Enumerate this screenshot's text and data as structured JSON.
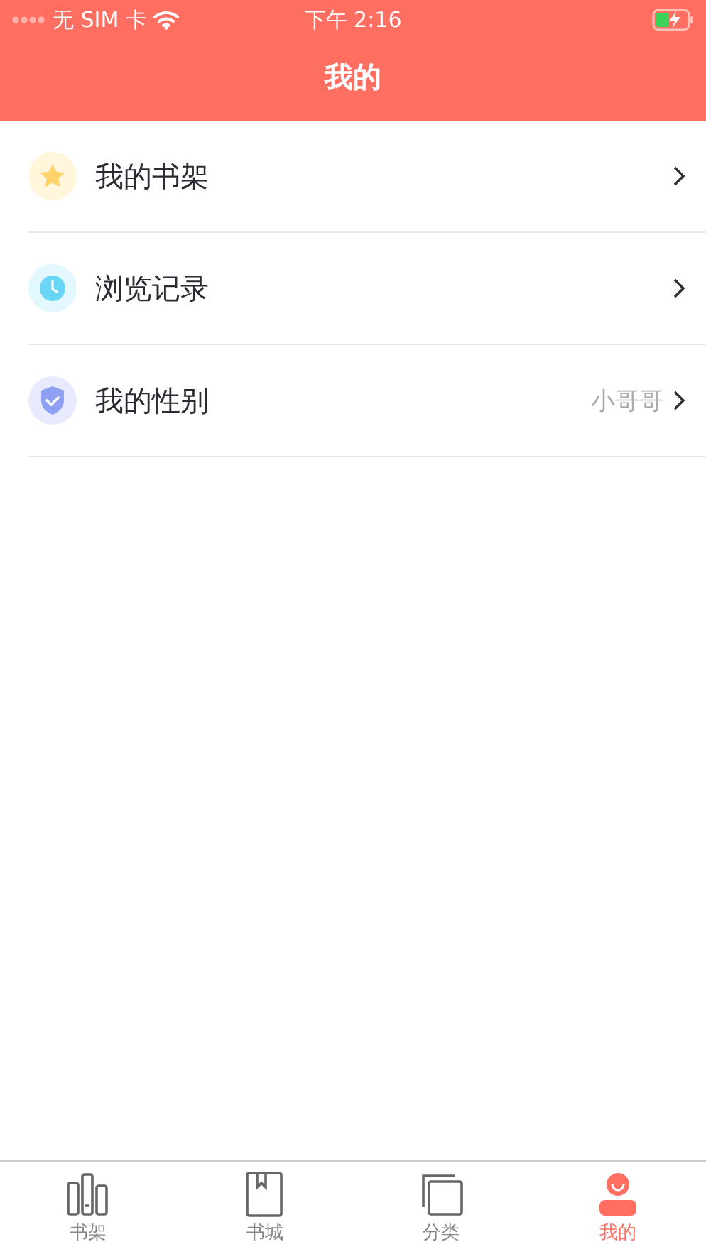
{
  "status_bar": {
    "carrier": "无 SIM 卡",
    "time": "下午 2:16"
  },
  "header": {
    "title": "我的"
  },
  "menu": [
    {
      "kind": "star",
      "label": "我的书架"
    },
    {
      "kind": "clock",
      "label": "浏览记录"
    },
    {
      "kind": "shield",
      "label": "我的性别",
      "value": "小哥哥"
    }
  ],
  "tabs": [
    {
      "kind": "shelf",
      "label": "书架",
      "selected": false
    },
    {
      "kind": "book",
      "label": "书城",
      "selected": false
    },
    {
      "kind": "category",
      "label": "分类",
      "selected": false
    },
    {
      "kind": "person",
      "label": "我的",
      "selected": true
    }
  ]
}
